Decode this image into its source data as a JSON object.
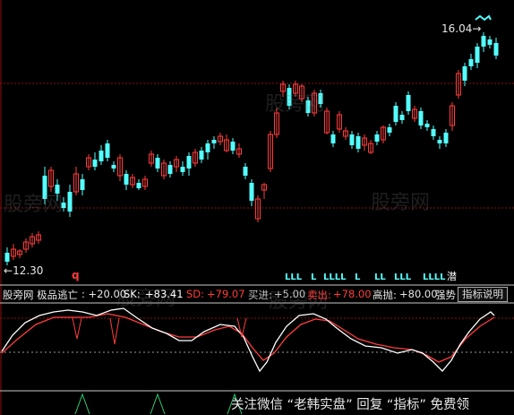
{
  "price_labels": {
    "high": "16.04",
    "low": "12.30"
  },
  "arrow_glyph": "←",
  "signal_q": "q",
  "markers": [
    "LLL",
    "L",
    "LLLL",
    "L",
    "LL",
    "LLL",
    "LLLL",
    "潜"
  ],
  "indicator": {
    "name": "股旁网 极品逃亡",
    "sk": ": +20.00",
    "sk_label": "SK: ",
    "sk_value": "+83.41",
    "sd_label": "SD: ",
    "sd_value": "+79.07",
    "buy_label": "买进:",
    "buy_value": "+5.00",
    "sell_label": "卖出:",
    "sell_value": "+78.00",
    "high_sell_label": "高抛:",
    "high_sell_value": "+80.00",
    "strong_label": "强势",
    "help_button": "指标说明"
  },
  "watermarks": [
    "股旁网",
    "股旁网",
    "股旁网",
    "股旁网",
    "股旁网"
  ],
  "footer_text": "关注微信 “老韩实盘” 回复 “指标” 免费领",
  "colors": {
    "up": "#ff3c3c",
    "down": "#54ffff",
    "sk": "#ffffff",
    "sd": "#ff3c3c",
    "grid": "#8a1010"
  }
}
